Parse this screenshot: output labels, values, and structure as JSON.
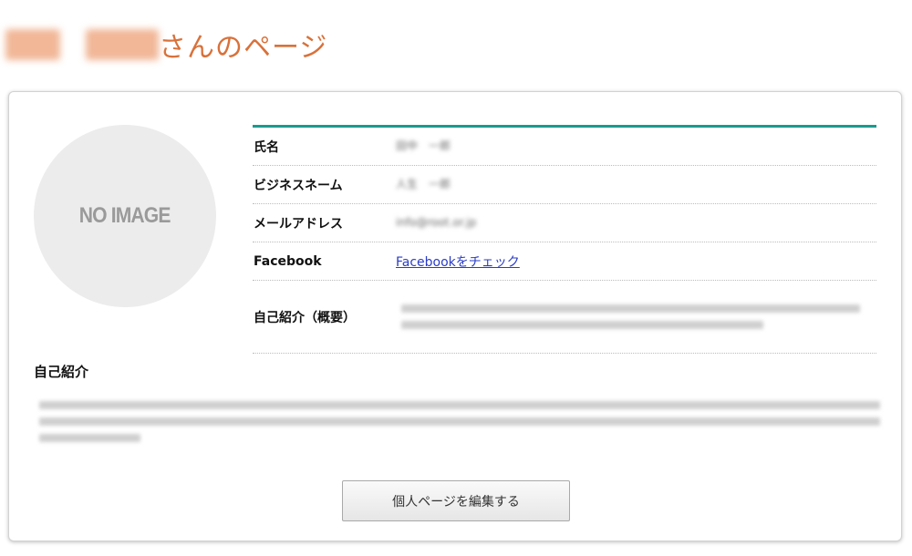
{
  "header": {
    "title_suffix": "さんのページ"
  },
  "avatar": {
    "placeholder_text": "NO IMAGE"
  },
  "profile": {
    "rows": [
      {
        "label": "氏名",
        "value": "田中　一郎"
      },
      {
        "label": "ビジネスネーム",
        "value": "人生　一郎"
      },
      {
        "label": "メールアドレス",
        "value": "info@root.or.jp"
      },
      {
        "label": "Facebook",
        "value": "Facebookをチェック"
      },
      {
        "label": "自己紹介（概要）",
        "value": ""
      }
    ]
  },
  "intro": {
    "heading": "自己紹介"
  },
  "actions": {
    "edit_label": "個人ページを編集する"
  },
  "colors": {
    "title": "#d9713a",
    "accent_border": "#1a9a8f",
    "link": "#2a3cc7",
    "avatar_bg": "#ececec"
  }
}
